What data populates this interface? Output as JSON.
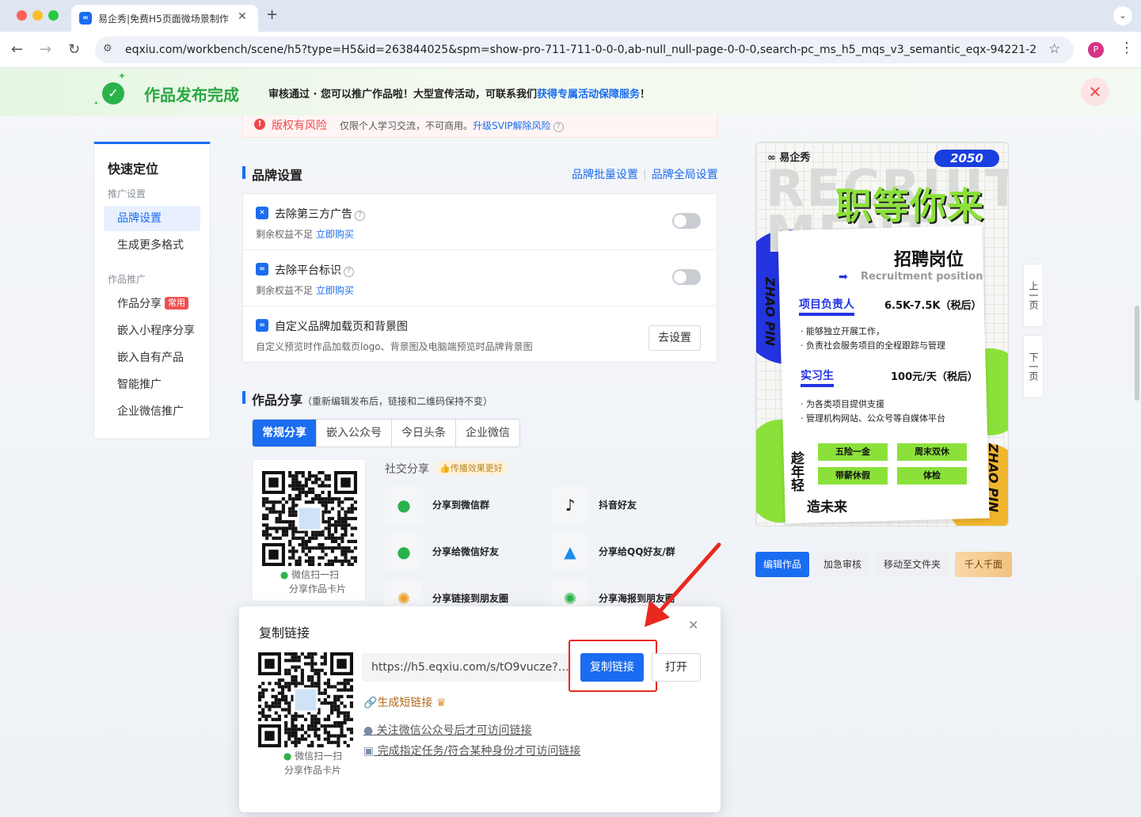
{
  "browser": {
    "tab_title": "易企秀|免费H5页面微场景制作",
    "favicon": "eq-logo-icon",
    "url": "eqxiu.com/workbench/scene/h5?type=H5&id=263844025&spm=show-pro-711-711-0-0-0,ab-null_null-page-0-0-0,search-pc_ms_h5_mqs_v3_semantic_eqx-94221-2025...",
    "profile_initial": "P"
  },
  "banner": {
    "title": "作品发布完成",
    "text": "审核通过 · 您可以推广作品啦！大型宣传活动，可联系我们",
    "link": "获得专属活动保障服务",
    "suffix": "！",
    "close": "✕"
  },
  "nav": {
    "title": "快速定位",
    "group1": "推广设置",
    "group1_items": [
      "品牌设置",
      "生成更多格式"
    ],
    "group2": "作品推广",
    "group2_items": [
      "作品分享",
      "嵌入小程序分享",
      "嵌入自有产品",
      "智能推广",
      "企业微信推广"
    ],
    "share_badge": "常用"
  },
  "risk": {
    "title": "版权有风险",
    "text": "仅限个人学习交流，不可商用。",
    "link": "升级SVIP解除风险"
  },
  "brand": {
    "title": "品牌设置",
    "link_batch": "品牌批量设置",
    "link_global": "品牌全局设置",
    "rows": [
      {
        "title": "去除第三方广告",
        "sub": "剩余权益不足",
        "link": "立即购买"
      },
      {
        "title": "去除平台标识",
        "sub": "剩余权益不足",
        "link": "立即购买"
      },
      {
        "title": "自定义品牌加载页和背景图",
        "sub": "自定义预览时作品加载页logo、背景图及电脑端预览时品牌背景图",
        "button": "去设置"
      }
    ]
  },
  "share": {
    "title": "作品分享",
    "note": "（重新编辑发布后，链接和二维码保持不变）",
    "tabs": [
      "常规分享",
      "嵌入公众号",
      "今日头条",
      "企业微信"
    ],
    "qr_caption_1": "微信扫一扫",
    "qr_caption_2": "分享作品卡片",
    "social_title": "社交分享",
    "social_badge": "👍传播效果更好",
    "items": [
      {
        "label": "分享到微信群",
        "icon": "wechat-group-icon"
      },
      {
        "label": "抖音好友",
        "icon": "douyin-icon"
      },
      {
        "label": "分享给微信好友",
        "icon": "wechat-friend-icon"
      },
      {
        "label": "分享给QQ好友/群",
        "icon": "qq-icon"
      },
      {
        "label": "分享链接到朋友圈",
        "icon": "moments-icon"
      },
      {
        "label": "分享海报到朋友圈",
        "icon": "poster-moments-icon"
      }
    ]
  },
  "modal": {
    "title": "复制链接",
    "link_value": "https://h5.eqxiu.com/s/tO9vucze?ei...",
    "copy_button": "复制链接",
    "open_button": "打开",
    "short_link": "生成短链接",
    "follow_link": "关注微信公众号后才可访问链接",
    "task_link": "完成指定任务/符合某种身份才可访问链接",
    "qr_caption_1": "微信扫一扫",
    "qr_caption_2": "分享作品卡片"
  },
  "poster": {
    "logo": "易企秀",
    "year": "2050",
    "bg_word": "RECRUIT MENT",
    "headline": "职等你来",
    "jobs_title": "招聘岗位",
    "jobs_sub": "Recruitment position",
    "zhaopin": "ZHAO PIN",
    "role1": "项目负责人",
    "salary1": "6.5K-7.5K（税后）",
    "role1_lines": [
      "· 能够独立开展工作，",
      "· 负责社会服务项目的全程跟踪与管理"
    ],
    "role2": "实习生",
    "salary2": "100元/天（税后）",
    "role2_lines": [
      "· 为各类项目提供支援",
      "· 管理机构网站、公众号等自媒体平台"
    ],
    "tags": [
      "五险一金",
      "周末双休",
      "带薪休假",
      "体检"
    ],
    "vertical": "趁年轻",
    "slogan": "造未来"
  },
  "pager": {
    "up": "上一页",
    "down": "下一页"
  },
  "actions": {
    "edit": "编辑作品",
    "rush": "加急审核",
    "move": "移动至文件夹",
    "thousand": "千人千面"
  },
  "colors": {
    "accent": "#1a6cf0",
    "success": "#2aa842",
    "danger": "#f04848",
    "highlight": "#e8281e"
  }
}
